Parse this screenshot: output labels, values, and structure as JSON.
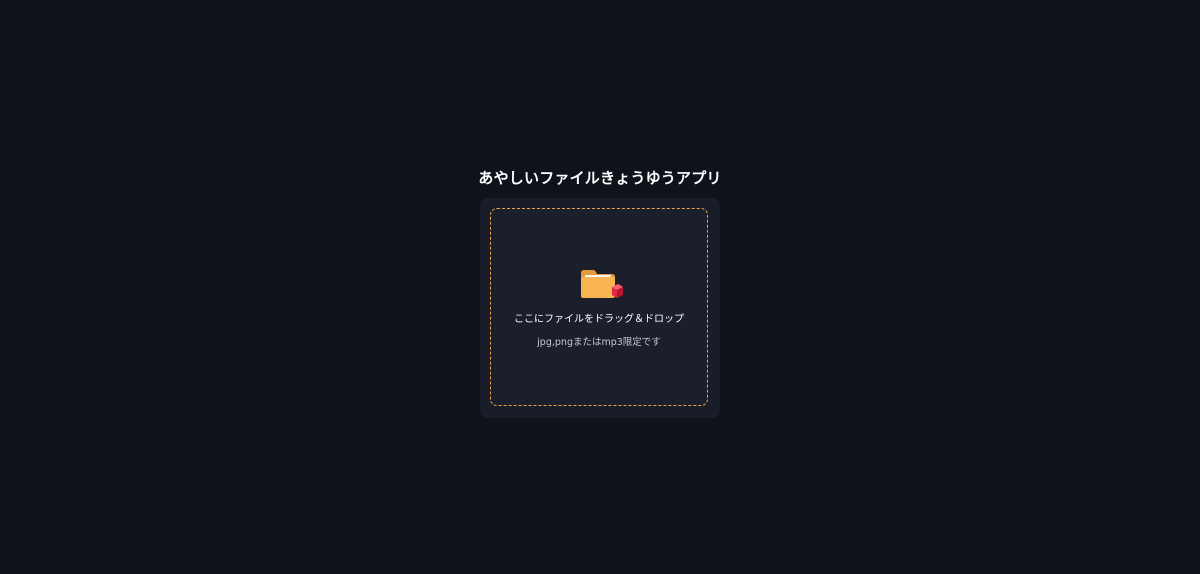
{
  "app": {
    "title": "あやしいファイルきょうゆうアプリ"
  },
  "dropzone": {
    "icon": "folder-with-cube-icon",
    "instruction": "ここにファイルをドラッグ＆ドロップ",
    "hint": "jpg,pngまたはmp3限定です"
  },
  "colors": {
    "background": "#0d121b",
    "card": "#181d29",
    "dashed_border": "#f0a24a",
    "folder": "#f6b04e",
    "cube": "#e02a45"
  }
}
